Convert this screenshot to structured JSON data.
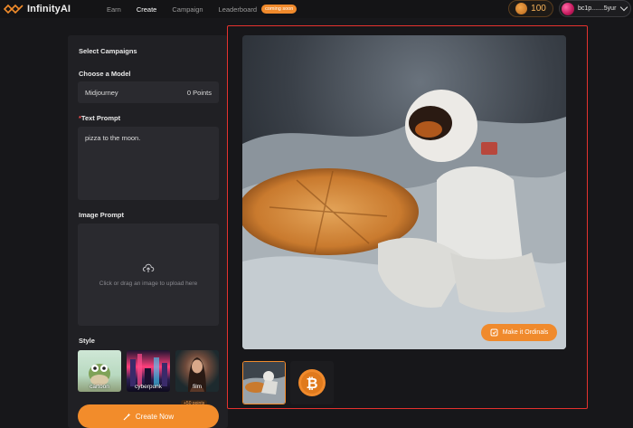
{
  "app": {
    "name": "InfinityAI"
  },
  "nav": {
    "items": [
      {
        "label": "Earn",
        "active": false
      },
      {
        "label": "Create",
        "active": true
      },
      {
        "label": "Campaign",
        "active": false
      },
      {
        "label": "Leaderboard",
        "active": false
      }
    ],
    "coming_soon_badge": "coming soon"
  },
  "header": {
    "points": "100",
    "coin_icon": "coin-icon",
    "wallet_address": "bc1p.......5yur"
  },
  "form": {
    "campaigns_title": "Select Campaigns",
    "model_title": "Choose a Model",
    "model_name": "Midjourney",
    "model_points": "0 Points",
    "text_prompt_title": "Text Prompt",
    "required_mark": "*",
    "text_prompt_value": "pizza to the moon.",
    "image_prompt_title": "Image Prompt",
    "upload_text": "Click or drag an image to upload here",
    "style_title": "Style",
    "styles": [
      {
        "label": "cartoon"
      },
      {
        "label": "cyberpunk"
      },
      {
        "label": "film"
      }
    ],
    "bonus_badge": "+50 points",
    "create_label": "Create Now"
  },
  "result": {
    "ordinals_label": "Make it Ordinals"
  },
  "colors": {
    "accent": "#f28c2b",
    "frame_highlight": "#e5322e",
    "panel_bg": "#202024"
  }
}
